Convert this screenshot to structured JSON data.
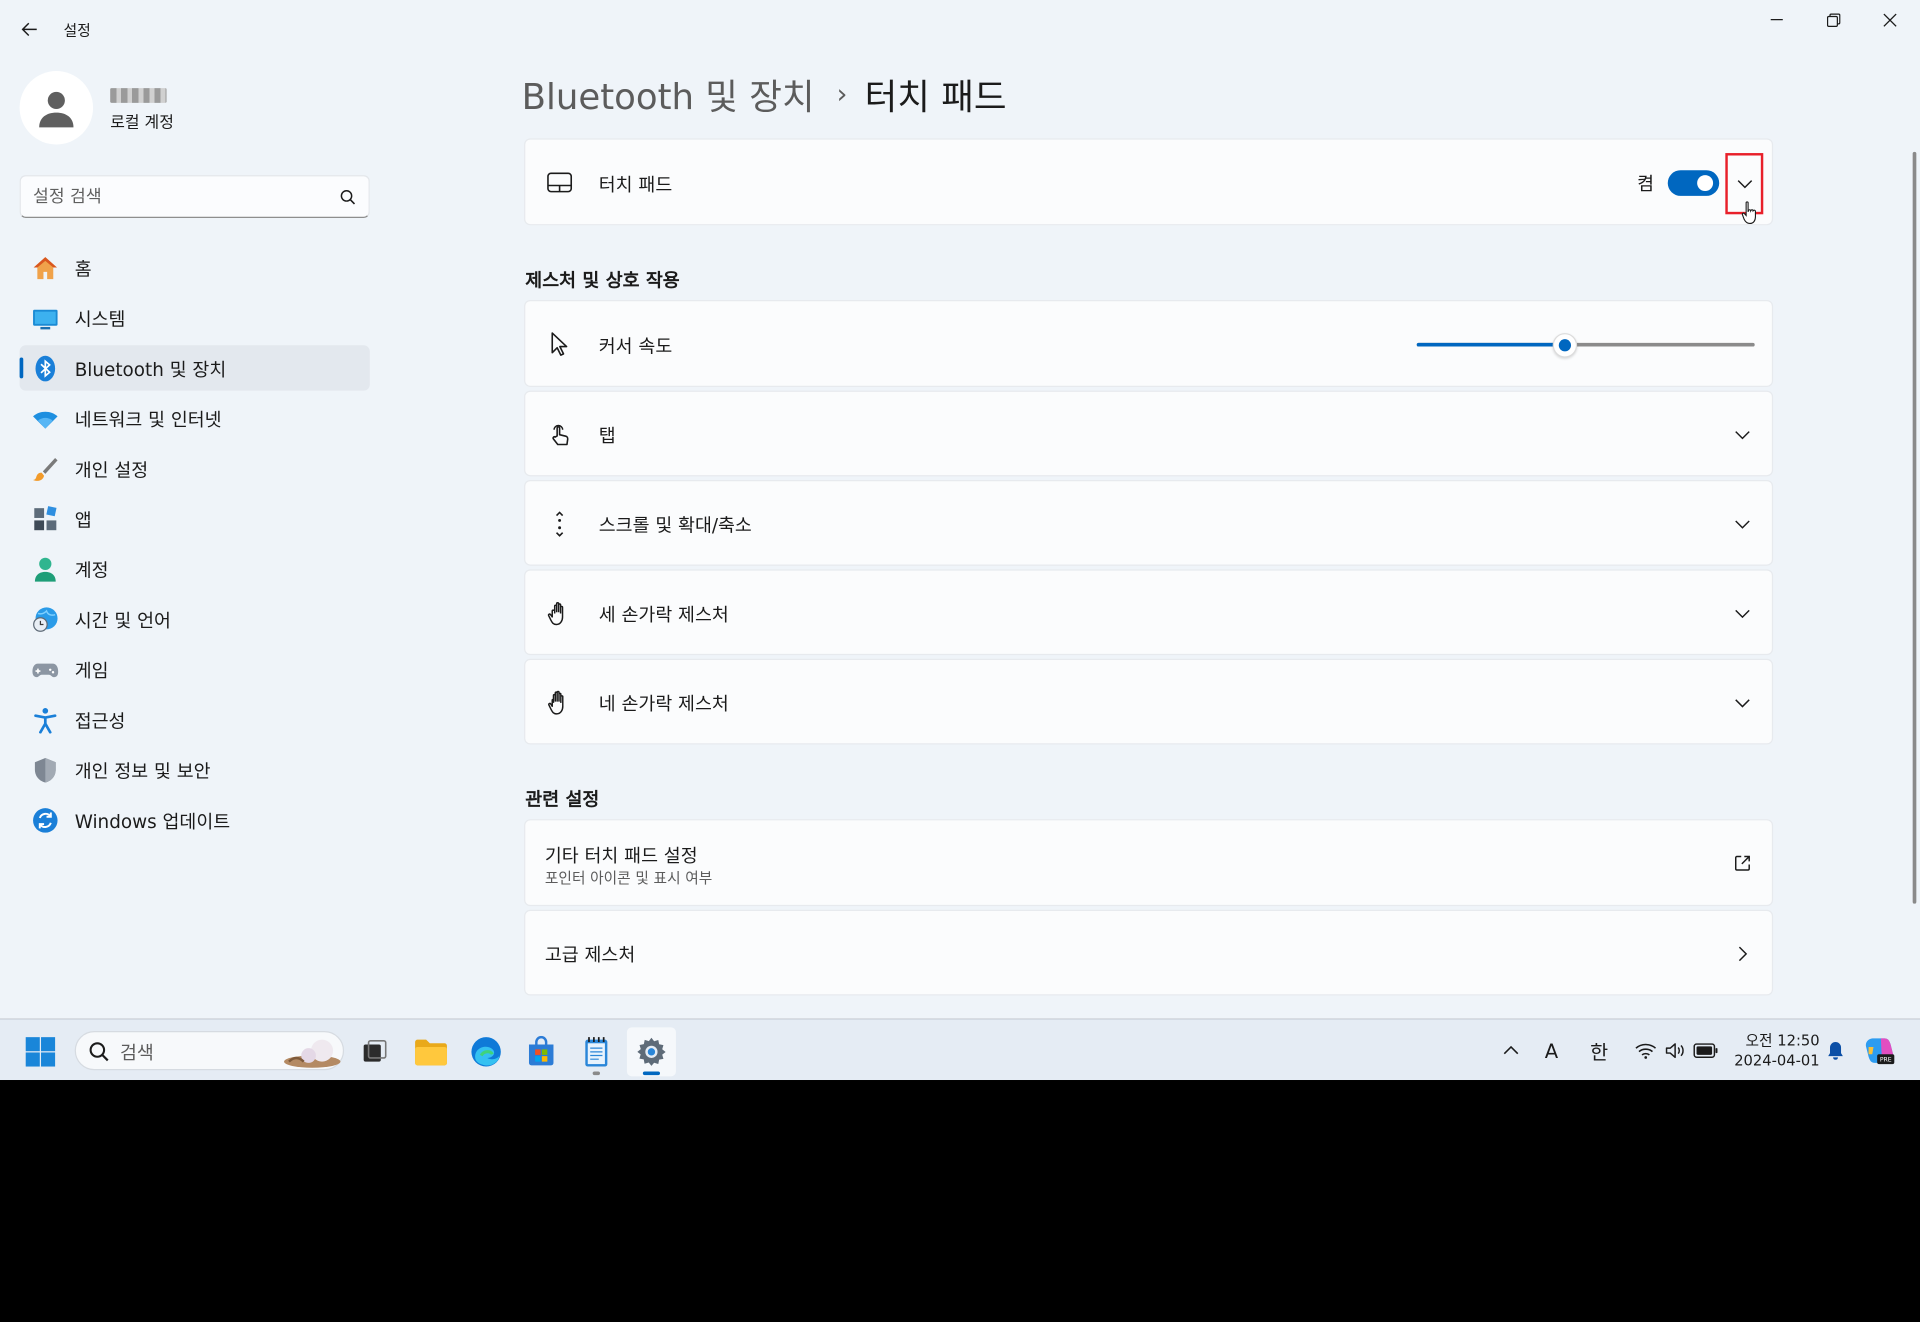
{
  "window": {
    "app_title": "설정",
    "colors": {
      "accent": "#0067c0",
      "highlight_box": "#e8202a"
    }
  },
  "profile": {
    "account_type": "로컬 계정"
  },
  "search": {
    "placeholder": "설정 검색"
  },
  "nav": {
    "items": [
      {
        "label": "홈",
        "icon": "home-icon"
      },
      {
        "label": "시스템",
        "icon": "system-icon"
      },
      {
        "label": "Bluetooth 및 장치",
        "icon": "bluetooth-icon",
        "active": true
      },
      {
        "label": "네트워크 및 인터넷",
        "icon": "wifi-icon"
      },
      {
        "label": "개인 설정",
        "icon": "brush-icon"
      },
      {
        "label": "앱",
        "icon": "apps-icon"
      },
      {
        "label": "계정",
        "icon": "account-icon"
      },
      {
        "label": "시간 및 언어",
        "icon": "globe-clock-icon"
      },
      {
        "label": "게임",
        "icon": "gamepad-icon"
      },
      {
        "label": "접근성",
        "icon": "accessibility-icon"
      },
      {
        "label": "개인 정보 및 보안",
        "icon": "shield-icon"
      },
      {
        "label": "Windows 업데이트",
        "icon": "update-icon"
      }
    ]
  },
  "page": {
    "breadcrumb_parent": "Bluetooth 및 장치",
    "breadcrumb_sep": "›",
    "breadcrumb_current": "터치 패드"
  },
  "touchpad": {
    "label": "터치 패드",
    "toggle_state": "켬",
    "toggle_on": true
  },
  "gestures": {
    "title": "제스처 및 상호 작용",
    "cursor_speed_label": "커서 속도",
    "cursor_speed_fraction": 0.44,
    "items": [
      {
        "label": "탭",
        "icon": "tap-icon"
      },
      {
        "label": "스크롤 및 확대/축소",
        "icon": "scroll-icon"
      },
      {
        "label": "세 손가락 제스처",
        "icon": "three-finger-icon"
      },
      {
        "label": "네 손가락 제스처",
        "icon": "four-finger-icon"
      }
    ]
  },
  "related": {
    "title": "관련 설정",
    "other_title": "기타 터치 패드 설정",
    "other_sub": "포인터 아이콘 및 표시 여부",
    "advanced_title": "고급 제스처"
  },
  "taskbar": {
    "search_placeholder": "검색",
    "tray": {
      "ime_mode": "A",
      "ime_lang": "한"
    },
    "clock_time": "오전 12:50",
    "clock_date": "2024-04-01"
  }
}
